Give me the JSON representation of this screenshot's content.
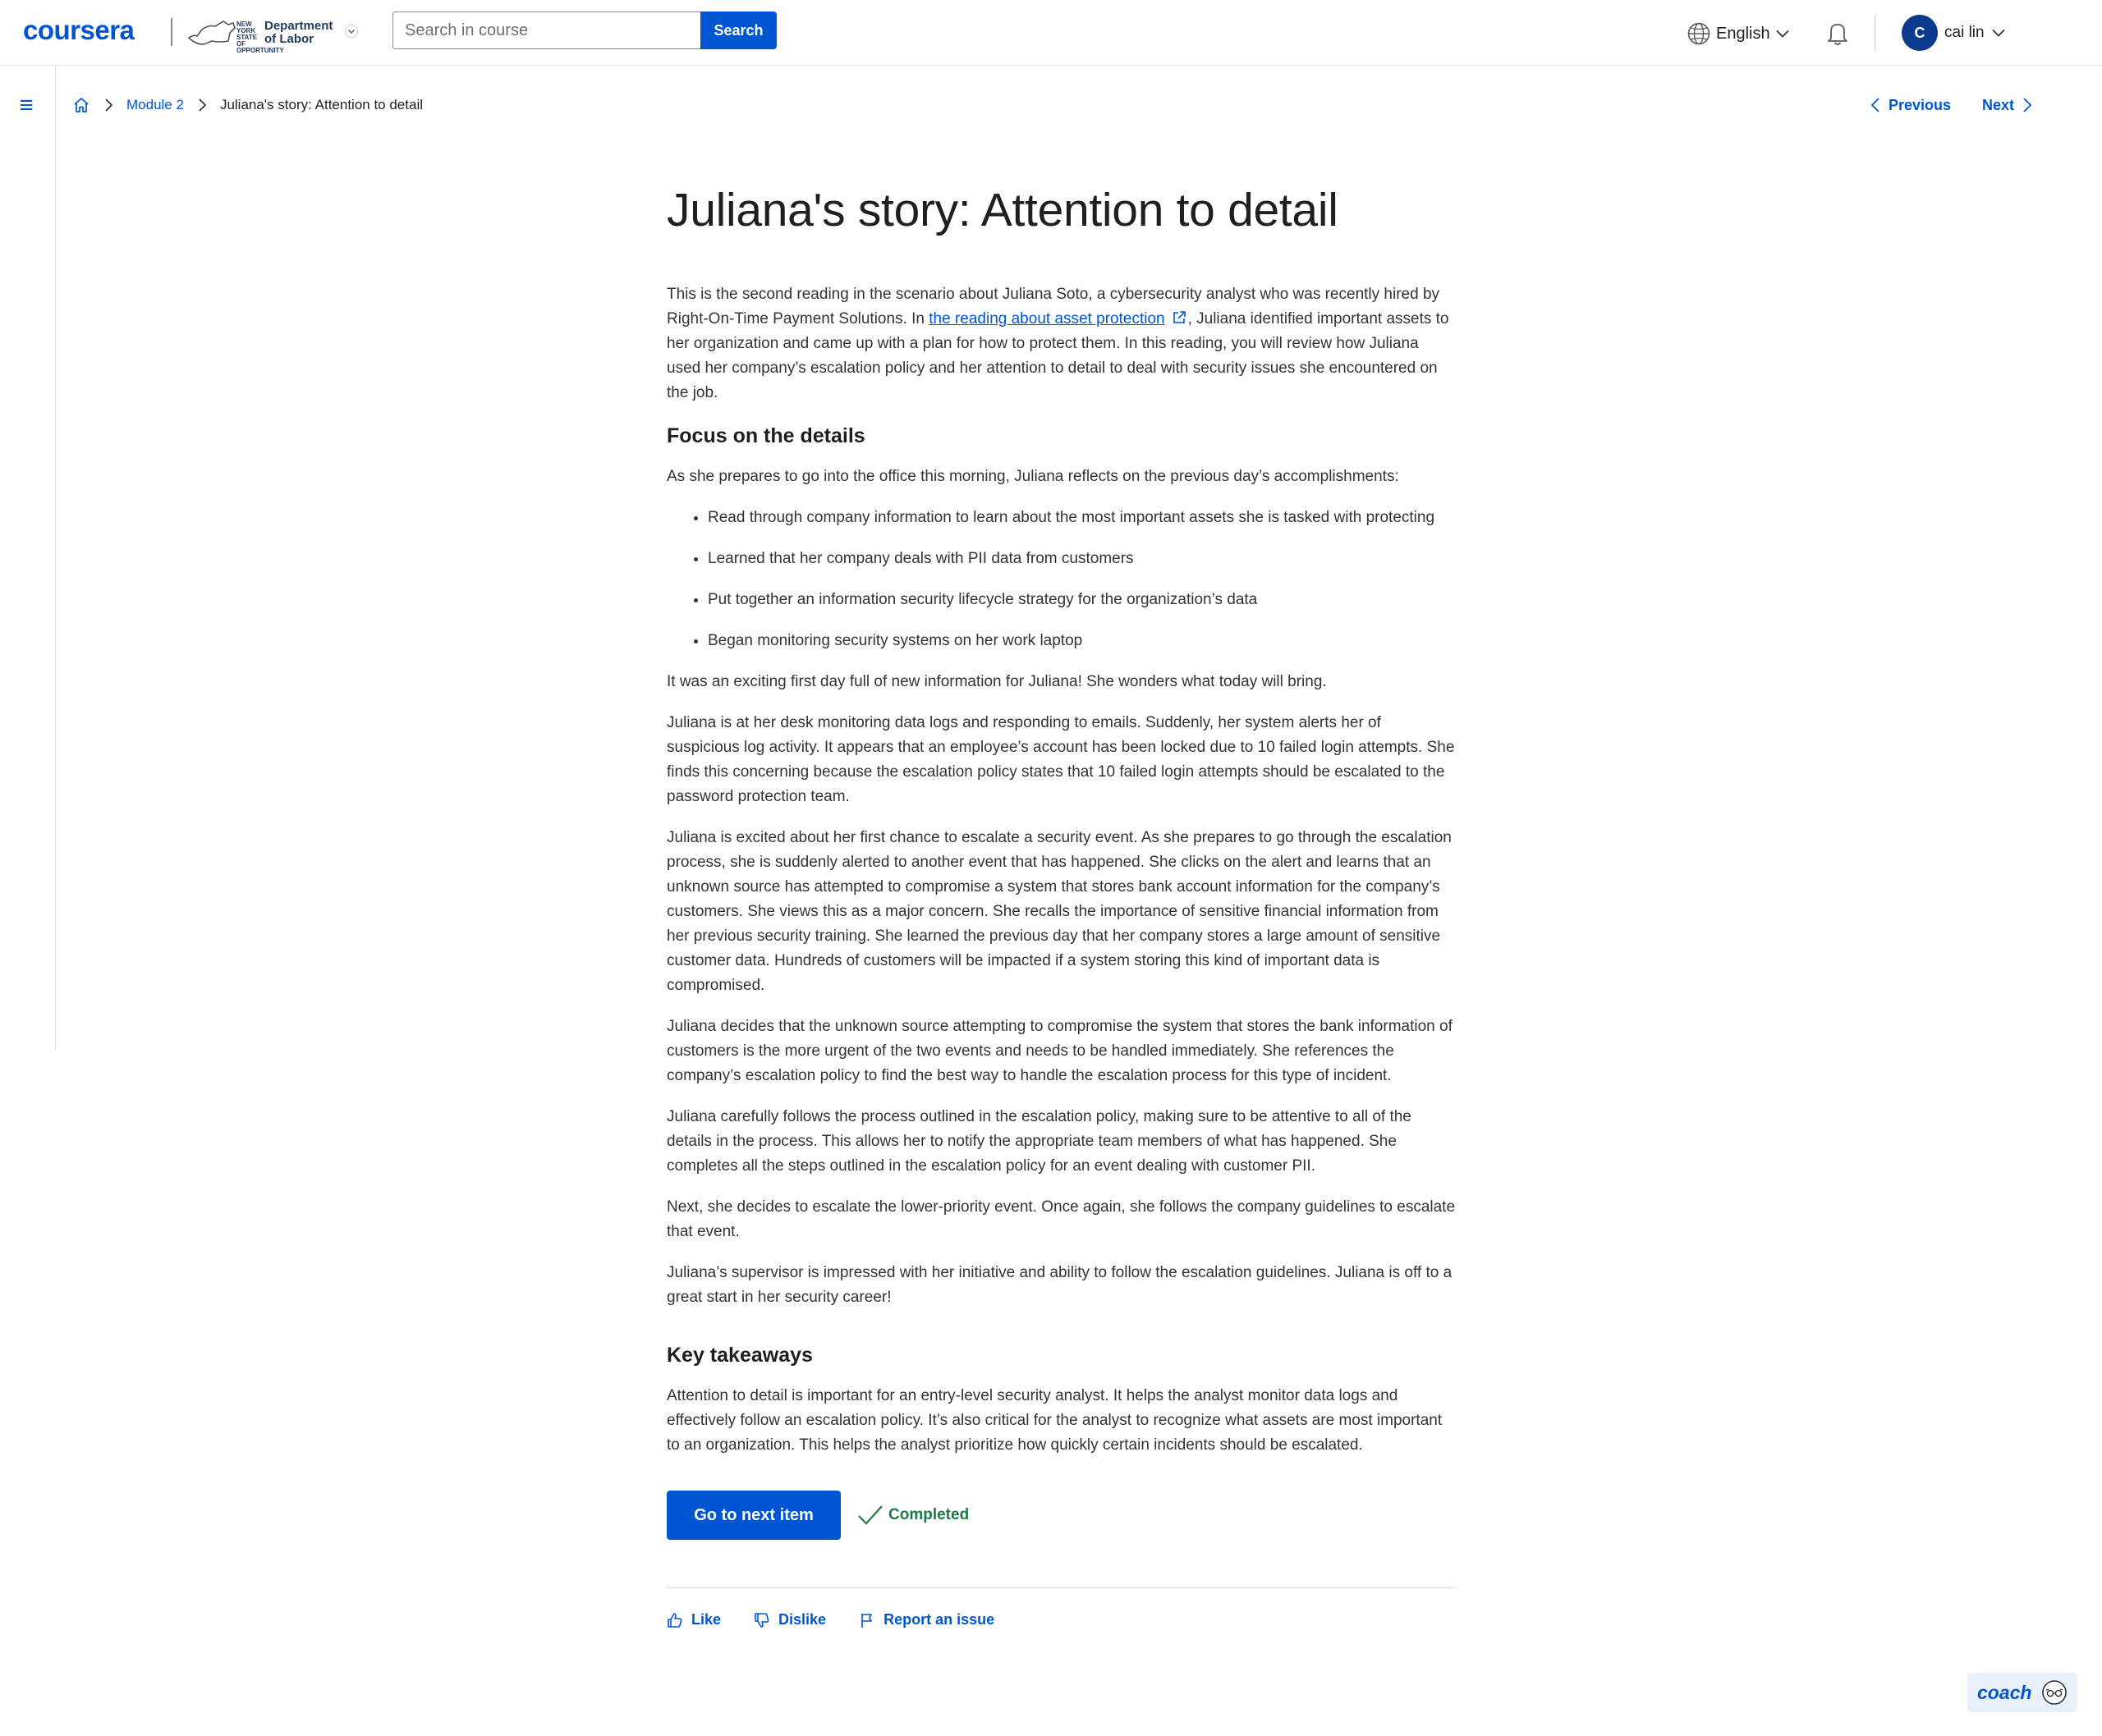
{
  "header": {
    "logo": "coursera",
    "partner": {
      "ny_text": "NEW YORK STATE OF OPPORTUNITY",
      "dept_line1": "Department",
      "dept_line2": "of Labor"
    },
    "search": {
      "placeholder": "Search in course",
      "value": "",
      "button_label": "Search"
    },
    "language": "English",
    "user": {
      "initial": "C",
      "name": "cai lin"
    }
  },
  "breadcrumb": {
    "module": "Module 2",
    "current": "Juliana's story: Attention to detail"
  },
  "pager": {
    "previous": "Previous",
    "next": "Next"
  },
  "article": {
    "title": "Juliana's story: Attention to detail",
    "intro": {
      "before_link": "This is the second reading in the scenario about Juliana Soto, a cybersecurity analyst who was recently hired by Right-On-Time Payment Solutions. In ",
      "link_text": "the reading about asset protection",
      "after_link": ", Juliana identified important assets to her organization and came up with a plan for how to protect them. In this reading, you will review how Juliana used her company’s escalation policy and her attention to detail to deal with security issues she encountered on the job."
    },
    "heading_focus": "Focus on the details",
    "focus_lead": "As she prepares to go into the office this morning, Juliana reflects on the previous day’s accomplishments:",
    "bullets": [
      "Read through company information to learn about the most important assets she is tasked with protecting",
      "Learned that her company deals with PII data from customers",
      "Put together an information security lifecycle strategy for the organization’s data",
      "Began monitoring security systems on her work laptop"
    ],
    "paragraphs": [
      "It was an exciting first day full of new information for Juliana! She wonders what today will bring.",
      "Juliana is at her desk monitoring data logs and responding to emails. Suddenly, her system alerts her of suspicious log activity. It appears that an employee’s account has been locked due to 10 failed login attempts. She finds this concerning because the escalation policy states that 10 failed login attempts should be escalated to the password protection team.",
      "Juliana is excited about her first chance to escalate a security event. As she prepares to go through the escalation process, she is suddenly alerted to another event that has happened. She clicks on the alert and learns that an unknown source has attempted to compromise a system that stores bank account information for the company’s customers. She views this as a major concern. She recalls the importance of sensitive financial information from her previous security training. She learned the previous day that her company stores a large amount of sensitive customer data. Hundreds of customers will be impacted if a system storing this kind of important data is compromised.",
      "Juliana decides that the unknown source attempting to compromise the system that stores the bank information of customers is the more urgent of the two events and needs to be handled immediately. She references the company’s escalation policy to find the best way to handle the escalation process for this type of incident.",
      "Juliana carefully follows the process outlined in the escalation policy, making sure to be attentive to all of the details in the process. This allows her to notify the appropriate team members of what has happened. She completes all the steps outlined in the escalation policy for an event dealing with customer PII.",
      "Next, she decides to escalate the lower-priority event. Once again, she follows the company guidelines to escalate that event.",
      "Juliana’s supervisor is impressed with her initiative and ability to follow the escalation guidelines. Juliana is off to a great start in her security career!"
    ],
    "heading_takeaways": "Key takeaways",
    "takeaways": "Attention to detail is important for an entry-level security analyst. It helps the analyst monitor data logs and effectively follow an escalation policy. It’s also critical for the analyst to recognize what assets are most important to an organization. This helps the analyst prioritize how quickly certain incidents should be escalated."
  },
  "actions": {
    "next_item": "Go to next item",
    "status": "Completed"
  },
  "feedback": {
    "like": "Like",
    "dislike": "Dislike",
    "report": "Report an issue"
  },
  "coach": {
    "label": "coach"
  },
  "colors": {
    "brand": "#0056d2",
    "success": "#1e7a44",
    "avatar": "#0b3a8f"
  }
}
